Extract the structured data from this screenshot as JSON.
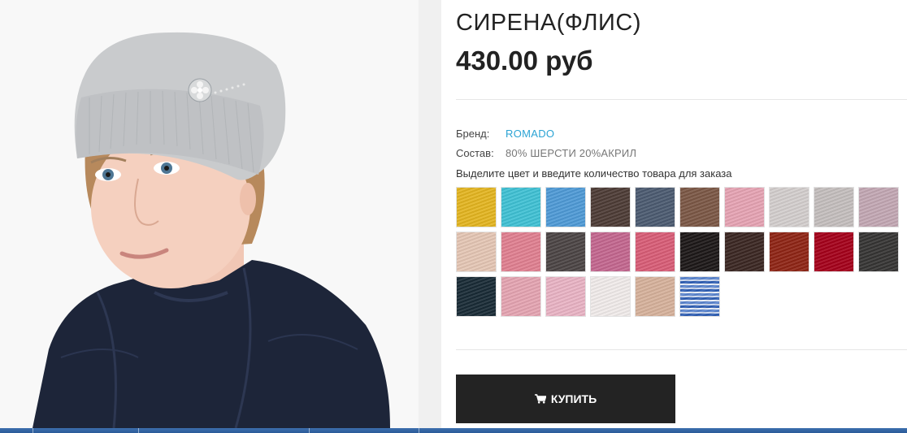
{
  "product": {
    "title": "СИРЕНА(ФЛИС)",
    "price": "430.00 руб",
    "brand_label": "Бренд:",
    "brand_value": "ROMADO",
    "composition_label": "Состав:",
    "composition_value": "80% ШЕРСТИ 20%АКРИЛ",
    "instruction": "Выделите цвет и введите количество товара для заказа",
    "image_icon": "product-photo-hat-model"
  },
  "swatches": [
    {
      "color": "#e3b520"
    },
    {
      "color": "#3fc1d4"
    },
    {
      "color": "#4e9ad6"
    },
    {
      "color": "#4d3b35"
    },
    {
      "color": "#4b5a70"
    },
    {
      "color": "#7b5745"
    },
    {
      "color": "#e6a3b3"
    },
    {
      "color": "#d3cecd"
    },
    {
      "color": "#c4bebd"
    },
    {
      "color": "#c2a7b3"
    },
    {
      "color": "#e4c6b4"
    },
    {
      "color": "#e07f90"
    },
    {
      "color": "#4b4444"
    },
    {
      "color": "#c3668e"
    },
    {
      "color": "#d85c76"
    },
    {
      "color": "#1c1717"
    },
    {
      "color": "#3a2622"
    },
    {
      "color": "#8e2414"
    },
    {
      "color": "#a5001a"
    },
    {
      "color": "#353433"
    },
    {
      "color": "#182a35"
    },
    {
      "color": "#e4a4b1"
    },
    {
      "color": "#e9b3c4"
    },
    {
      "color": "#f0ebea"
    },
    {
      "color": "#d6b19b"
    },
    {
      "color": "#4f7cc6",
      "pattern": "space-dyed"
    }
  ],
  "buy_button": {
    "label": "КУПИТЬ",
    "icon": "cart-icon"
  },
  "colors": {
    "accent_link": "#2ba3d4",
    "button_bg": "#232323"
  }
}
